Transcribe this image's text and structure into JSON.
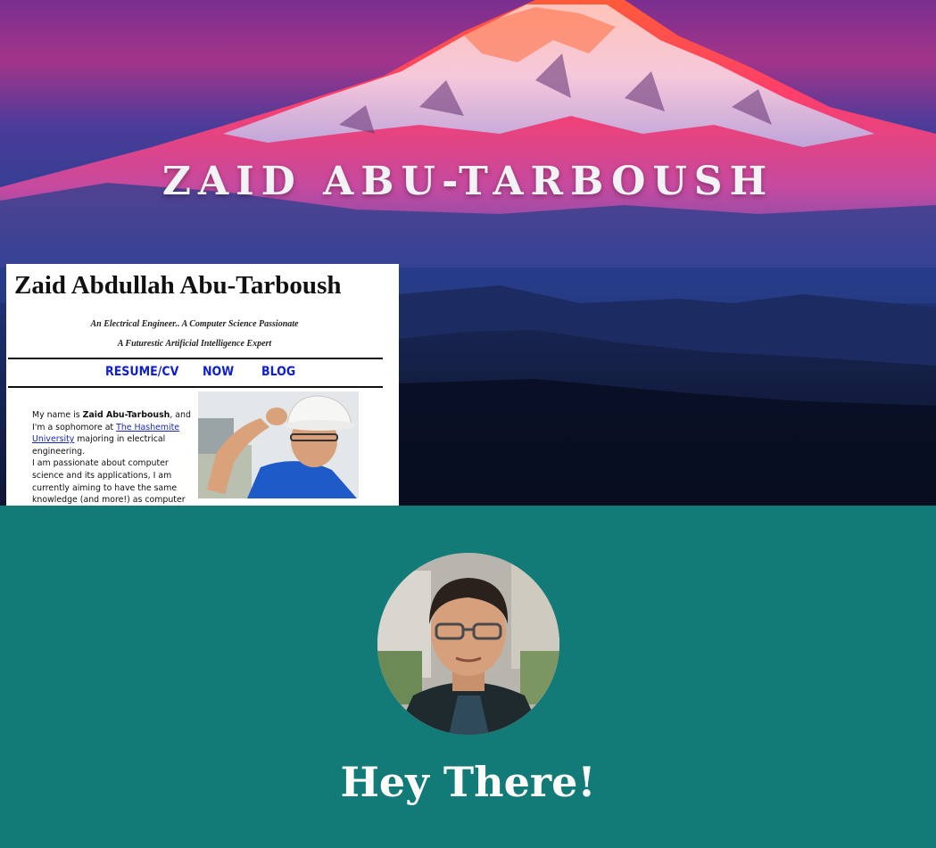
{
  "hero": {
    "title": "ZAID ABU-TARBOUSH"
  },
  "old_site": {
    "name": "Zaid Abdullah Abu-Tarboush",
    "tagline_1": "An Electrical Engineer.. A Computer Science Passionate",
    "tagline_2": "A Futurestic Artificial Intelligence Expert",
    "nav": {
      "resume": "RESUME/CV",
      "now": "NOW",
      "blog": "BLOG"
    },
    "bio": {
      "p1": "My name is ",
      "name_bold": "Zaid Abu-Tarboush",
      "p2": ", and I'm a sophomore at ",
      "university_link": "The Hashemite University",
      "p3": " majoring in electrical engineering.",
      "p4": "I am passionate about computer science and its applications, I am currently aiming to have the same knowledge (and more!) as computer science master students. I am doing so after I formed a curriculum"
    }
  },
  "intro": {
    "greeting": "Hey There!"
  },
  "colors": {
    "teal_background": "#127b77",
    "nav_link": "#1020d0"
  }
}
